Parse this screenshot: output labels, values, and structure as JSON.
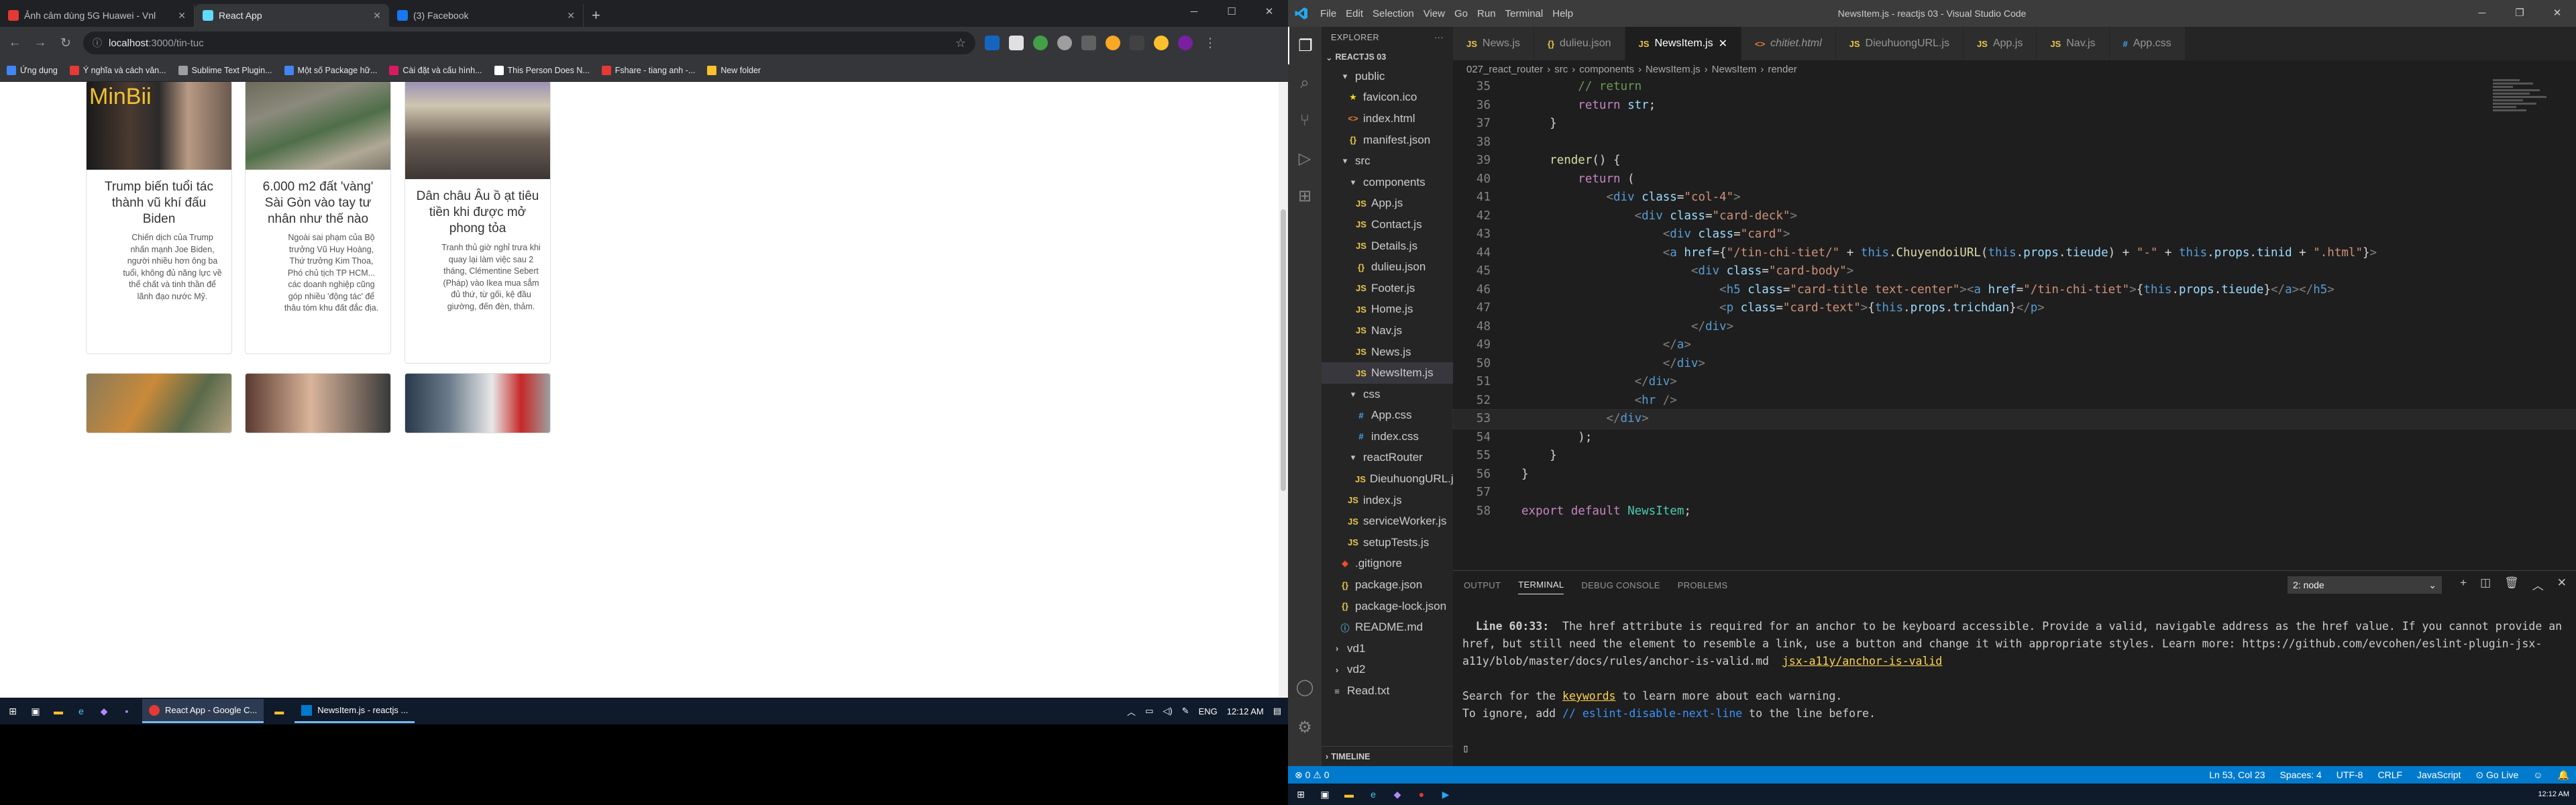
{
  "chrome": {
    "tabs": [
      {
        "title": "Ảnh cảm dùng 5G Huawei - Vnl",
        "color": "#e53935"
      },
      {
        "title": "React App",
        "color": "#61dafb"
      },
      {
        "title": "(3) Facebook",
        "color": "#1877f2"
      }
    ],
    "url_host": "localhost",
    "url_rest": ":3000/tin-tuc",
    "bookmarks": [
      {
        "label": "Ứng dụng",
        "color": "#4285f4"
      },
      {
        "label": "Ý nghĩa và cách vân...",
        "color": "#e53935"
      },
      {
        "label": "Sublime Text Plugin...",
        "color": "#9e9e9e"
      },
      {
        "label": "Một số Package hữ...",
        "color": "#4285f4"
      },
      {
        "label": "Cài đặt và cấu hình...",
        "color": "#d81b60"
      },
      {
        "label": "This Person Does N...",
        "color": "#ffffff"
      },
      {
        "label": "Fshare - tiang anh -...",
        "color": "#e53935"
      },
      {
        "label": "New folder",
        "color": "#fbc02d"
      }
    ]
  },
  "news": {
    "watermark": "MinBii",
    "cards": [
      {
        "title": "Trump biến tuổi tác thành vũ khí đấu Biden",
        "text": "Chiến dịch của Trump nhấn mạnh Joe Biden, người nhiều hơn ông ba tuổi, không đủ năng lực về thể chất và tinh thần để lãnh đạo nước Mỹ."
      },
      {
        "title": "6.000 m2 đất 'vàng' Sài Gòn vào tay tư nhân như thế nào",
        "text": "Ngoài sai phạm của Bộ trưởng Vũ Huy Hoàng, Thứ trưởng Kim Thoa, Phó chủ tịch TP HCM... các doanh nghiệp cũng góp nhiều 'động tác' để thâu tóm khu đất đắc địa."
      },
      {
        "title": "Dân châu Âu ồ ạt tiêu tiền khi được mở phong tỏa",
        "text": "Tranh thủ giờ nghỉ trưa khi quay lại làm việc sau 2 tháng, Clémentine Sebert (Pháp) vào Ikea mua sắm đủ thứ, từ gối, kệ đầu giường, đến đèn, thảm."
      }
    ]
  },
  "taskbar_left": {
    "apps": [
      "React App - Google C...",
      "NewsItem.js - reactjs ..."
    ],
    "lang": "ENG",
    "time": "12:12 AM"
  },
  "vscode": {
    "window_title": "NewsItem.js - reactjs 03 - Visual Studio Code",
    "menu": [
      "File",
      "Edit",
      "Selection",
      "View",
      "Go",
      "Run",
      "Terminal",
      "Help"
    ],
    "explorer_title": "EXPLORER",
    "project": "REACTJS 03",
    "tree": [
      {
        "label": "public",
        "icon": "▾",
        "depth": 1,
        "type": "folder"
      },
      {
        "label": "favicon.ico",
        "icon": "★",
        "depth": 2,
        "type": "ico"
      },
      {
        "label": "index.html",
        "icon": "<>",
        "depth": 2,
        "type": "html"
      },
      {
        "label": "manifest.json",
        "icon": "{}",
        "depth": 2,
        "type": "json"
      },
      {
        "label": "src",
        "icon": "▾",
        "depth": 1,
        "type": "folder"
      },
      {
        "label": "components",
        "icon": "▾",
        "depth": 2,
        "type": "folder"
      },
      {
        "label": "App.js",
        "icon": "JS",
        "depth": 3,
        "type": "js"
      },
      {
        "label": "Contact.js",
        "icon": "JS",
        "depth": 3,
        "type": "js"
      },
      {
        "label": "Details.js",
        "icon": "JS",
        "depth": 3,
        "type": "js"
      },
      {
        "label": "dulieu.json",
        "icon": "{}",
        "depth": 3,
        "type": "json"
      },
      {
        "label": "Footer.js",
        "icon": "JS",
        "depth": 3,
        "type": "js"
      },
      {
        "label": "Home.js",
        "icon": "JS",
        "depth": 3,
        "type": "js"
      },
      {
        "label": "Nav.js",
        "icon": "JS",
        "depth": 3,
        "type": "js"
      },
      {
        "label": "News.js",
        "icon": "JS",
        "depth": 3,
        "type": "js"
      },
      {
        "label": "NewsItem.js",
        "icon": "JS",
        "depth": 3,
        "type": "js",
        "selected": true
      },
      {
        "label": "css",
        "icon": "▾",
        "depth": 2,
        "type": "folder"
      },
      {
        "label": "App.css",
        "icon": "#",
        "depth": 3,
        "type": "css"
      },
      {
        "label": "index.css",
        "icon": "#",
        "depth": 3,
        "type": "css"
      },
      {
        "label": "reactRouter",
        "icon": "▾",
        "depth": 2,
        "type": "folder"
      },
      {
        "label": "DieuhuongURL.js",
        "icon": "JS",
        "depth": 3,
        "type": "js"
      },
      {
        "label": "index.js",
        "icon": "JS",
        "depth": 2,
        "type": "js"
      },
      {
        "label": "serviceWorker.js",
        "icon": "JS",
        "depth": 2,
        "type": "js"
      },
      {
        "label": "setupTests.js",
        "icon": "JS",
        "depth": 2,
        "type": "js"
      },
      {
        "label": ".gitignore",
        "icon": "◆",
        "depth": 1,
        "type": "git"
      },
      {
        "label": "package.json",
        "icon": "{}",
        "depth": 1,
        "type": "json"
      },
      {
        "label": "package-lock.json",
        "icon": "{}",
        "depth": 1,
        "type": "json"
      },
      {
        "label": "README.md",
        "icon": "ⓘ",
        "depth": 1,
        "type": "md"
      },
      {
        "label": "vd1",
        "icon": "›",
        "depth": 0,
        "type": "folder"
      },
      {
        "label": "vd2",
        "icon": "›",
        "depth": 0,
        "type": "folder"
      },
      {
        "label": "Read.txt",
        "icon": "≡",
        "depth": 0,
        "type": "txt"
      }
    ],
    "timeline": "TIMELINE",
    "tabs": [
      {
        "label": "News.js",
        "icon": "JS",
        "type": "js"
      },
      {
        "label": "dulieu.json",
        "icon": "{}",
        "type": "json"
      },
      {
        "label": "NewsItem.js",
        "icon": "JS",
        "type": "js",
        "active": true
      },
      {
        "label": "chitiet.html",
        "icon": "<>",
        "type": "html",
        "italic": true
      },
      {
        "label": "DieuhuongURL.js",
        "icon": "JS",
        "type": "js"
      },
      {
        "label": "App.js",
        "icon": "JS",
        "type": "js"
      },
      {
        "label": "Nav.js",
        "icon": "JS",
        "type": "js"
      },
      {
        "label": "App.css",
        "icon": "#",
        "type": "css"
      }
    ],
    "breadcrumb": [
      "027_react_router",
      "src",
      "components",
      "NewsItem.js",
      "NewsItem",
      "render"
    ],
    "code": [
      {
        "n": 35,
        "html": "<span class='c'>        // return</span>"
      },
      {
        "n": 36,
        "html": "        <span class='k'>return</span> <span class='a'>str</span>;"
      },
      {
        "n": 37,
        "html": "    }"
      },
      {
        "n": 38,
        "html": ""
      },
      {
        "n": 39,
        "html": "    <span class='f'>render</span>() {"
      },
      {
        "n": 40,
        "html": "        <span class='k'>return</span> ("
      },
      {
        "n": 41,
        "html": "            <span class='g'>&lt;</span><span class='t'>div</span> <span class='a'>class</span>=<span class='s'>\"col-4\"</span><span class='g'>&gt;</span>"
      },
      {
        "n": 42,
        "html": "                <span class='g'>&lt;</span><span class='t'>div</span> <span class='a'>class</span>=<span class='s'>\"card-deck\"</span><span class='g'>&gt;</span>"
      },
      {
        "n": 43,
        "html": "                    <span class='g'>&lt;</span><span class='t'>div</span> <span class='a'>class</span>=<span class='s'>\"card\"</span><span class='g'>&gt;</span>"
      },
      {
        "n": 44,
        "html": "                    <span class='g'>&lt;</span><span class='t'>a</span> <span class='a'>href</span>={<span class='s'>\"/tin-chi-tiet/\"</span> + <span class='kb'>this</span>.<span class='f'>ChuyendoiURL</span>(<span class='kb'>this</span>.<span class='a'>props</span>.<span class='a'>tieude</span>) + <span class='s'>\"-\"</span> + <span class='kb'>this</span>.<span class='a'>props</span>.<span class='a'>tinid</span> + <span class='s'>\".html\"</span>}<span class='g'>&gt;</span>"
      },
      {
        "n": 45,
        "html": "                        <span class='g'>&lt;</span><span class='t'>div</span> <span class='a'>class</span>=<span class='s'>\"card-body\"</span><span class='g'>&gt;</span>"
      },
      {
        "n": 46,
        "html": "                            <span class='g'>&lt;</span><span class='t'>h5</span> <span class='a'>class</span>=<span class='s'>\"card-title text-center\"</span><span class='g'>&gt;&lt;</span><span class='t'>a</span> <span class='a'>href</span>=<span class='s'>\"/tin-chi-tiet\"</span><span class='g'>&gt;</span>{<span class='kb'>this</span>.<span class='a'>props</span>.<span class='a'>tieude</span>}<span class='g'>&lt;/</span><span class='t'>a</span><span class='g'>&gt;&lt;/</span><span class='t'>h5</span><span class='g'>&gt;</span>"
      },
      {
        "n": 47,
        "html": "                            <span class='g'>&lt;</span><span class='t'>p</span> <span class='a'>class</span>=<span class='s'>\"card-text\"</span><span class='g'>&gt;</span>{<span class='kb'>this</span>.<span class='a'>props</span>.<span class='a'>trichdan</span>}<span class='g'>&lt;/</span><span class='t'>p</span><span class='g'>&gt;</span>"
      },
      {
        "n": 48,
        "html": "                        <span class='g'>&lt;/</span><span class='t'>div</span><span class='g'>&gt;</span>"
      },
      {
        "n": 49,
        "html": "                    <span class='g'>&lt;/</span><span class='t'>a</span><span class='g'>&gt;</span>"
      },
      {
        "n": 50,
        "html": "                    <span class='g'>&lt;/</span><span class='t'>div</span><span class='g'>&gt;</span>"
      },
      {
        "n": 51,
        "html": "                <span class='g'>&lt;/</span><span class='t'>div</span><span class='g'>&gt;</span>"
      },
      {
        "n": 52,
        "html": "                <span class='g'>&lt;</span><span class='t'>hr</span> <span class='g'>/&gt;</span>"
      },
      {
        "n": 53,
        "html": "            <span class='g'>&lt;/</span><span class='t'>div</span><span class='g'>&gt;</span>",
        "active": true
      },
      {
        "n": 54,
        "html": "        );"
      },
      {
        "n": 55,
        "html": "    }"
      },
      {
        "n": 56,
        "html": "}"
      },
      {
        "n": 57,
        "html": ""
      },
      {
        "n": 58,
        "html": "<span class='k'>export</span> <span class='k'>default</span> <span class='cls'>NewsItem</span>;"
      }
    ],
    "panel_tabs": [
      "OUTPUT",
      "TERMINAL",
      "DEBUG CONSOLE",
      "PROBLEMS"
    ],
    "active_panel": "TERMINAL",
    "terminal_select": "2: node",
    "terminal_html": "  <b>Line 60:33:</b>  The href attribute is required for an anchor to be keyboard accessible. Provide a valid, navigable address as the href value. If you cannot provide an href, but still need the element to resemble a link, use a button and change it with appropriate styles. Learn more: https://github.com/evcohen/eslint-plugin-jsx-a11y/blob/master/docs/rules/anchor-is-valid.md  <span class='u'>jsx-a11y/anchor-is-valid</span>\n\nSearch for the <span class='u'>keywords</span> to learn more about each warning.\nTo ignore, add <span class='hl'>// eslint-disable-next-line</span> to the line before.\n\n<span>▯</span>",
    "status": {
      "errors": "⊗ 0  ⚠ 0",
      "position": "Ln 53, Col 23",
      "spaces": "Spaces: 4",
      "encoding": "UTF-8",
      "eol": "CRLF",
      "language": "JavaScript",
      "golive": "⊙ Go Live"
    },
    "time": "12:12 AM"
  }
}
